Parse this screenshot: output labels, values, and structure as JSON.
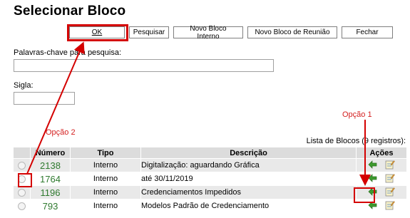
{
  "page": {
    "title": "Selecionar Bloco"
  },
  "toolbar": {
    "ok": "OK",
    "pesquisar": "Pesquisar",
    "novo_interno": "Novo Bloco Interno",
    "novo_reuniao": "Novo Bloco de Reunião",
    "fechar": "Fechar"
  },
  "search": {
    "keywords_label": "Palavras-chave para pesquisa:",
    "keywords_value": "",
    "sigla_label": "Sigla:",
    "sigla_value": ""
  },
  "annotations": {
    "opcao1": "Opção 1",
    "opcao2": "Opção 2",
    "highlight_color": "#d40000"
  },
  "list": {
    "caption": "Lista de Blocos (9 registros):",
    "headers": {
      "numero": "Número",
      "tipo": "Tipo",
      "descricao": "Descrição",
      "acoes": "Ações"
    },
    "rows": [
      {
        "numero": "2138",
        "tipo": "Interno",
        "descricao": "Digitalização: aguardando Gráfica"
      },
      {
        "numero": "1764",
        "tipo": "Interno",
        "descricao": "até 30/11/2019"
      },
      {
        "numero": "1196",
        "tipo": "Interno",
        "descricao": "Credenciamentos Impedidos"
      },
      {
        "numero": "793",
        "tipo": "Interno",
        "descricao": "Modelos Padrão de Credenciamento"
      }
    ],
    "action_icons": [
      "return-arrow-icon",
      "edit-note-icon"
    ]
  }
}
